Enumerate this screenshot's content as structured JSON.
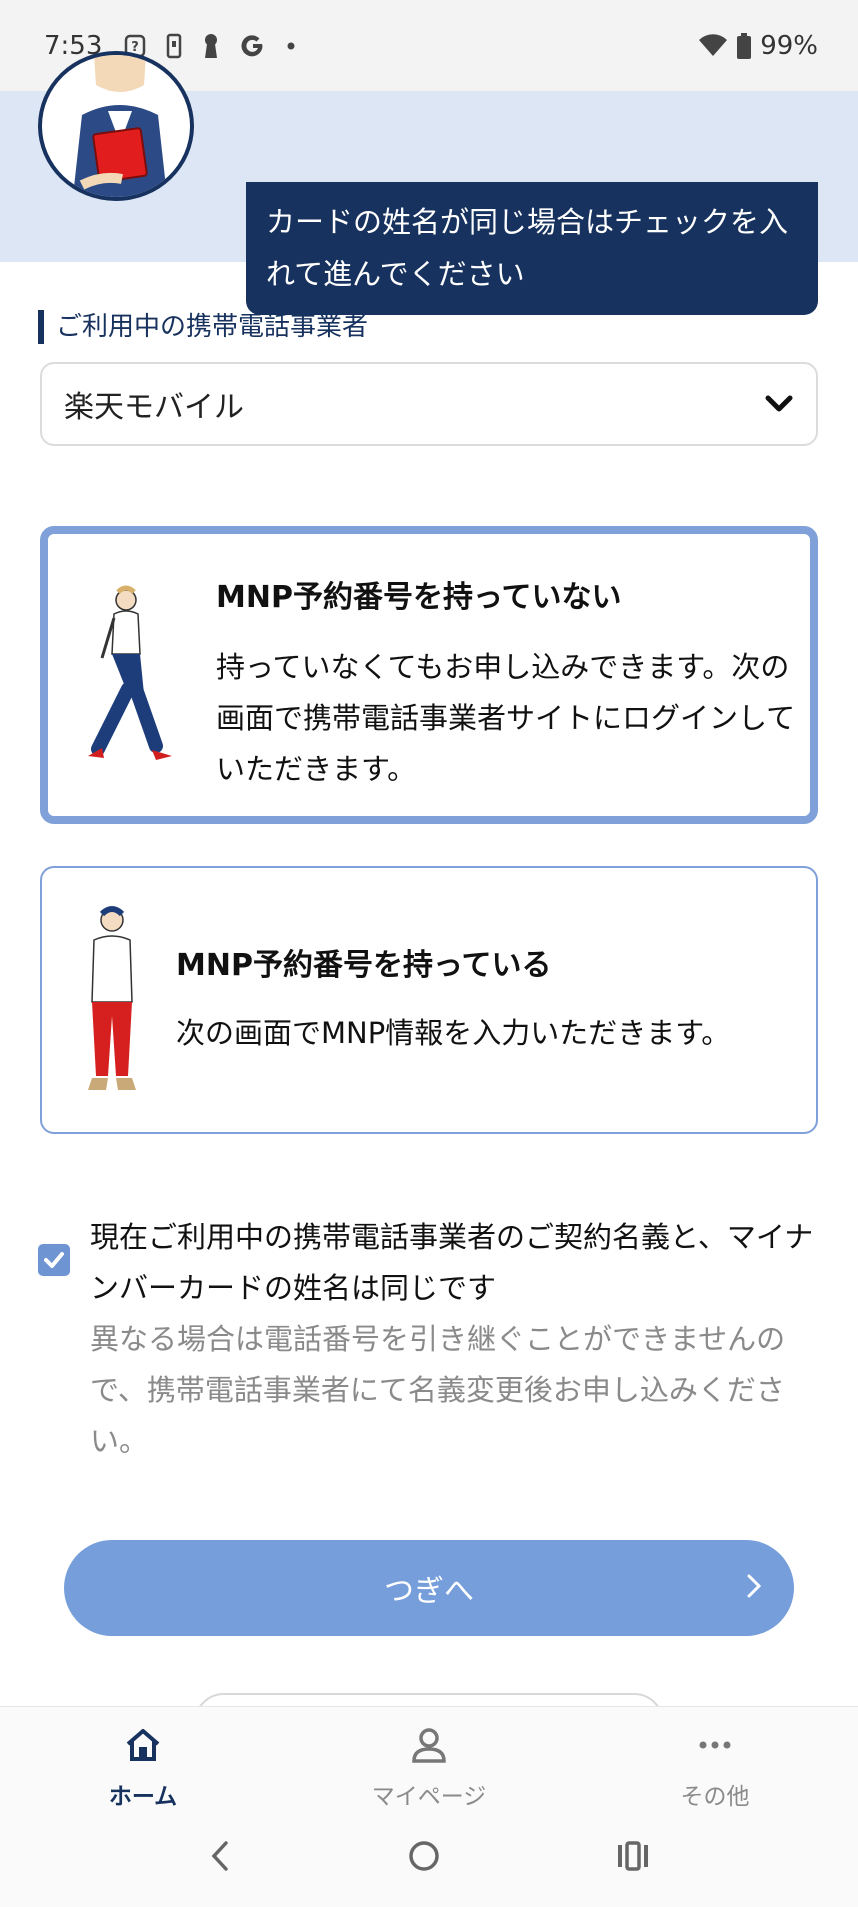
{
  "status_bar": {
    "time": "7:53",
    "battery": "99%",
    "icons": [
      "question-box-icon",
      "phone-icon",
      "keyhole-icon",
      "google-icon",
      "dot-icon",
      "wifi-icon",
      "battery-icon"
    ]
  },
  "banner": {
    "message": "カードの姓名が同じ場合はチェックを入れて進んでください"
  },
  "carrier": {
    "label": "ご利用中の携帯電話事業者",
    "selected": "楽天モバイル"
  },
  "options": [
    {
      "title": "MNP予約番号を持っていない",
      "description": "持っていなくてもお申し込みできます。次の画面で携帯電話事業者サイトにログインしていただきます。",
      "selected": true
    },
    {
      "title": "MNP予約番号を持っている",
      "description": "次の画面でMNP情報を入力いただきます。",
      "selected": false
    }
  ],
  "confirm": {
    "checked": true,
    "label": "現在ご利用中の携帯電話事業者のご契約名義と、マイナンバーカードの姓名は同じです",
    "note": "異なる場合は電話番号を引き継ぐことができませんので、携帯電話事業者にて名義変更後お申し込みください。"
  },
  "next_button": {
    "label": "つぎへ"
  },
  "bottom_nav": {
    "items": [
      {
        "label": "ホーム",
        "icon": "home-icon",
        "active": true
      },
      {
        "label": "マイページ",
        "icon": "person-icon",
        "active": false
      },
      {
        "label": "その他",
        "icon": "more-icon",
        "active": false
      }
    ]
  },
  "colors": {
    "navy": "#17325e",
    "accent_blue": "#7fa0d8",
    "button_blue": "#769edb",
    "banner_bg": "#dce6f4"
  }
}
